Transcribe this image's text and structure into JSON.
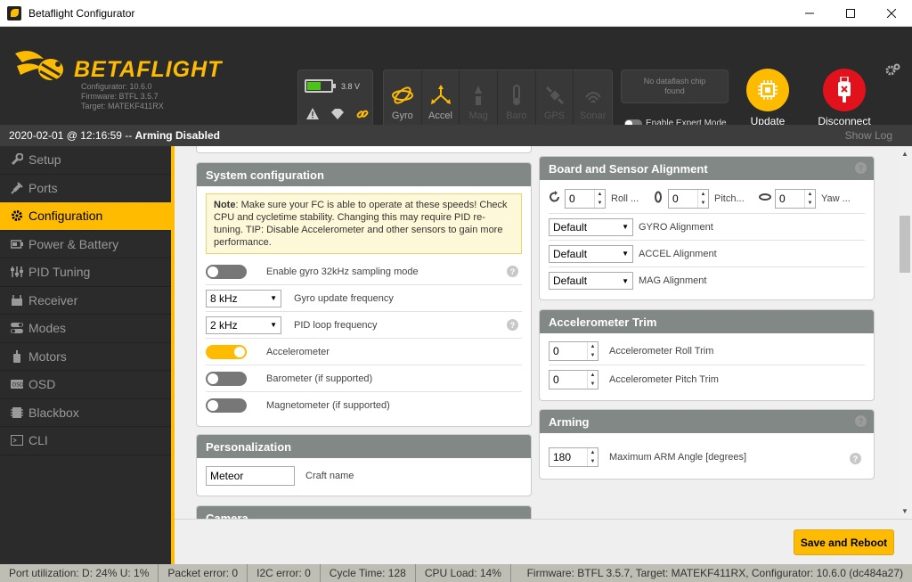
{
  "window": {
    "title": "Betaflight Configurator"
  },
  "header": {
    "logo_text": "BETAFLIGHT",
    "configurator": "Configurator: 10.6.0",
    "firmware": "Firmware: BTFL 3.5.7",
    "target": "Target: MATEKF411RX",
    "battery": {
      "voltage": "3.8 V",
      "level": 0.55
    },
    "sensors": [
      {
        "label": "Gyro",
        "active": true
      },
      {
        "label": "Accel",
        "active": true
      },
      {
        "label": "Mag",
        "active": false
      },
      {
        "label": "Baro",
        "active": false
      },
      {
        "label": "GPS",
        "active": false
      },
      {
        "label": "Sonar",
        "active": false
      }
    ],
    "dataflash": "No dataflash chip found",
    "expert_mode": "Enable Expert Mode",
    "update_firmware": "Update Firmware",
    "disconnect": "Disconnect"
  },
  "statusline": {
    "datetime": "2020-02-01 @ 12:16:59 --",
    "state": "Arming Disabled",
    "show_log": "Show Log"
  },
  "sidebar": {
    "items": [
      {
        "label": "Setup",
        "icon": "wrench-icon"
      },
      {
        "label": "Ports",
        "icon": "plug-icon"
      },
      {
        "label": "Configuration",
        "icon": "gear-icon"
      },
      {
        "label": "Power & Battery",
        "icon": "battery-icon"
      },
      {
        "label": "PID Tuning",
        "icon": "pid-icon"
      },
      {
        "label": "Receiver",
        "icon": "receiver-icon"
      },
      {
        "label": "Modes",
        "icon": "modes-icon"
      },
      {
        "label": "Motors",
        "icon": "motor-icon"
      },
      {
        "label": "OSD",
        "icon": "osd-icon"
      },
      {
        "label": "Blackbox",
        "icon": "blackbox-icon"
      },
      {
        "label": "CLI",
        "icon": "cli-icon"
      }
    ]
  },
  "system_config": {
    "title": "System configuration",
    "note_bold": "Note",
    "note_text": ": Make sure your FC is able to operate at these speeds! Check CPU and cycletime stability. Changing this may require PID re-tuning. TIP: Disable Accelerometer and other sensors to gain more performance.",
    "gyro32": "Enable gyro 32kHz sampling mode",
    "gyro_freq_value": "8 kHz",
    "gyro_freq_label": "Gyro update frequency",
    "pid_freq_value": "2 kHz",
    "pid_freq_label": "PID loop frequency",
    "accelerometer": "Accelerometer",
    "barometer": "Barometer (if supported)",
    "magnetometer": "Magnetometer (if supported)"
  },
  "personalization": {
    "title": "Personalization",
    "craft_value": "Meteor",
    "craft_label": "Craft name"
  },
  "camera": {
    "title": "Camera"
  },
  "alignment": {
    "title": "Board and Sensor Alignment",
    "roll_value": "0",
    "roll_label": "Roll ...",
    "pitch_value": "0",
    "pitch_label": "Pitch...",
    "yaw_value": "0",
    "yaw_label": "Yaw ...",
    "gyro_value": "Default",
    "gyro_label": "GYRO Alignment",
    "accel_value": "Default",
    "accel_label": "ACCEL Alignment",
    "mag_value": "Default",
    "mag_label": "MAG Alignment"
  },
  "acc_trim": {
    "title": "Accelerometer Trim",
    "roll_value": "0",
    "roll_label": "Accelerometer Roll Trim",
    "pitch_value": "0",
    "pitch_label": "Accelerometer Pitch Trim"
  },
  "arming": {
    "title": "Arming",
    "angle_value": "180",
    "angle_label": "Maximum ARM Angle [degrees]"
  },
  "footer": {
    "save": "Save and Reboot"
  },
  "statusbar": {
    "port": "Port utilization: D: 24% U: 1%",
    "packet": "Packet error: 0",
    "i2c": "I2C error: 0",
    "cycle": "Cycle Time: 128",
    "cpu": "CPU Load: 14%",
    "firmware": "Firmware: BTFL 3.5.7, Target: MATEKF411RX, Configurator: 10.6.0 (dc484a27)"
  },
  "help_symbol": "?",
  "colors": {
    "accent": "#ffbb00",
    "header": "#2b2b2b",
    "panel_head": "#828885",
    "disconnect": "#e2121c"
  }
}
